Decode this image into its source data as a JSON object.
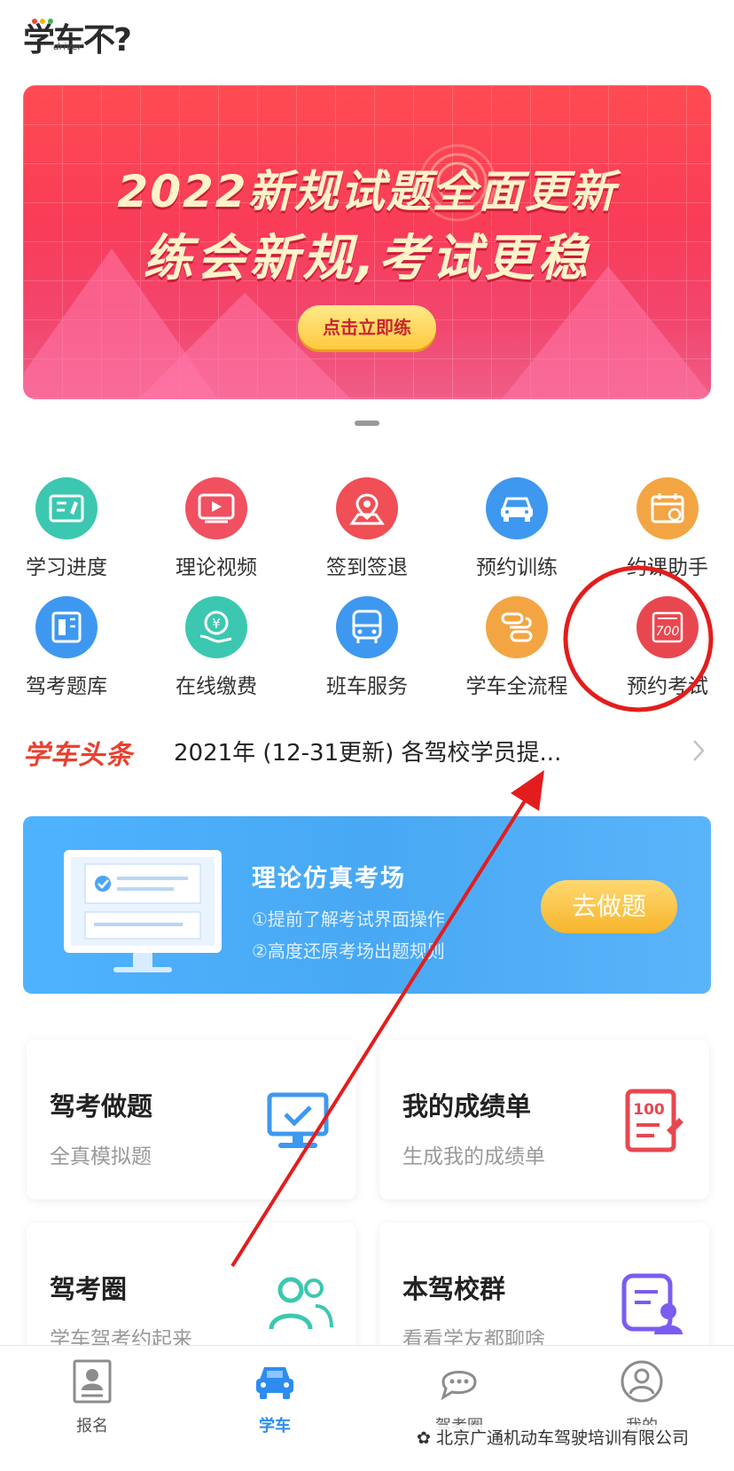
{
  "brand": {
    "logo_text": "学车不?",
    "logo_sub": "driver"
  },
  "banner": {
    "line1": "2022新规试题全面更新",
    "line2": "练会新规,考试更稳",
    "button": "点击立即练"
  },
  "grid": [
    {
      "label": "学习进度",
      "icon": "study-progress-icon",
      "color": "#3cc7b1"
    },
    {
      "label": "理论视频",
      "icon": "theory-video-icon",
      "color": "#f05060"
    },
    {
      "label": "签到签退",
      "icon": "check-in-icon",
      "color": "#ef4f55"
    },
    {
      "label": "预约训练",
      "icon": "car-training-icon",
      "color": "#3e98f0"
    },
    {
      "label": "约课助手",
      "icon": "calendar-icon",
      "color": "#f3a544"
    },
    {
      "label": "驾考题库",
      "icon": "question-bank-icon",
      "color": "#3e98f0"
    },
    {
      "label": "在线缴费",
      "icon": "payment-icon",
      "color": "#3cc7b1"
    },
    {
      "label": "班车服务",
      "icon": "bus-icon",
      "color": "#3e98f0"
    },
    {
      "label": "学车全流程",
      "icon": "process-icon",
      "color": "#f3a544"
    },
    {
      "label": "预约考试",
      "icon": "exam-booking-icon",
      "color": "#e8474f"
    }
  ],
  "headline": {
    "logo": "学车头条",
    "text": "2021年 (12-31更新) 各驾校学员提..."
  },
  "promo": {
    "title": "理论仿真考场",
    "line1": "①提前了解考试界面操作",
    "line2": "②高度还原考场出题规则",
    "button": "去做题"
  },
  "cards": [
    {
      "title": "驾考做题",
      "subtitle": "全真模拟题",
      "icon": "computer-exam-icon"
    },
    {
      "title": "我的成绩单",
      "subtitle": "生成我的成绩单",
      "icon": "score-report-icon"
    },
    {
      "title": "驾考圈",
      "subtitle": "学车驾考约起来",
      "icon": "community-icon"
    },
    {
      "title": "本驾校群",
      "subtitle": "看看学友都聊啥",
      "icon": "school-group-icon"
    }
  ],
  "tabs": [
    {
      "label": "报名",
      "icon": "register-icon",
      "active": false
    },
    {
      "label": "学车",
      "icon": "car-icon",
      "active": true
    },
    {
      "label": "驾考圈",
      "icon": "chat-icon",
      "active": false
    },
    {
      "label": "我的",
      "icon": "profile-icon",
      "active": false
    }
  ],
  "watermark": "北京广通机动车驾驶培训有限公司",
  "colors": {
    "accent": "#2d8cf0",
    "annotation": "#e31d1d"
  }
}
